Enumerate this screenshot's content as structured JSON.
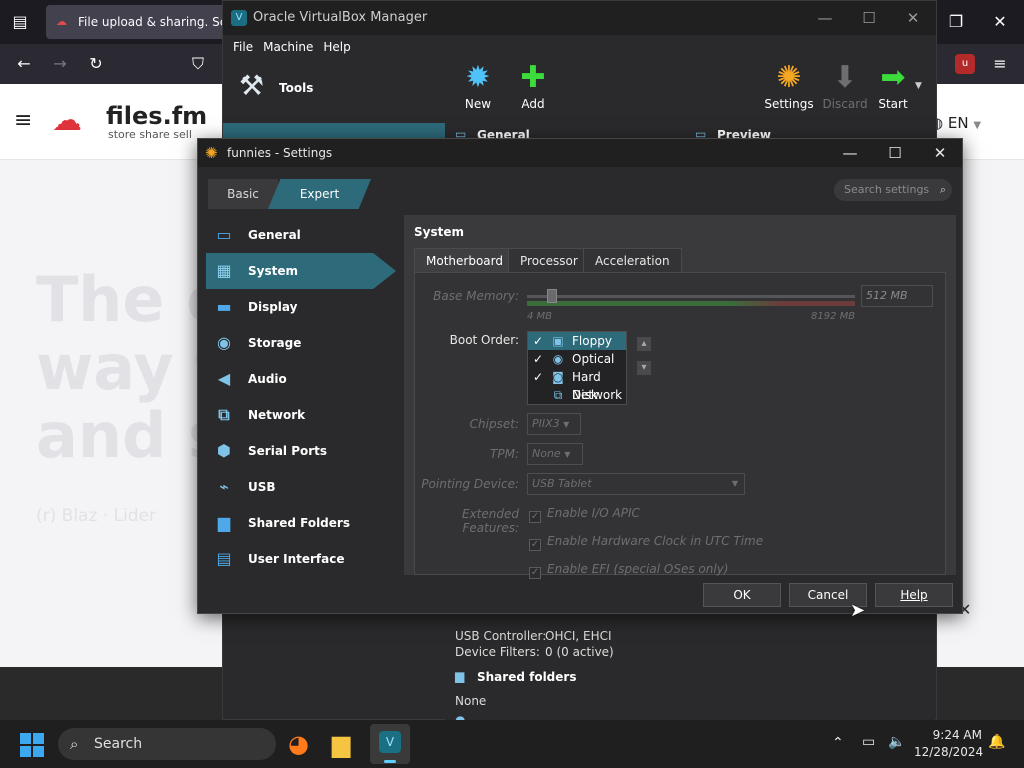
{
  "browser": {
    "tab_title": "File upload & sharing. Send",
    "site_logo_text": "files.fm",
    "site_tagline": "store share sell",
    "language": "EN",
    "hero_lines": [
      "The e",
      "way t",
      "and s"
    ],
    "hero_sub": "(r) Blaz · Lider"
  },
  "vbox_manager": {
    "title": "Oracle VirtualBox Manager",
    "menu": [
      "File",
      "Machine",
      "Help"
    ],
    "tools_label": "Tools",
    "toolbar": [
      {
        "label": "New",
        "icon": "new-icon"
      },
      {
        "label": "Add",
        "icon": "add-icon"
      },
      {
        "label": "Settings",
        "icon": "settings-icon"
      },
      {
        "label": "Discard",
        "icon": "discard-icon",
        "disabled": true
      },
      {
        "label": "Start",
        "icon": "start-icon"
      }
    ],
    "details": {
      "general_header": "General",
      "preview_header": "Preview",
      "usb_controller_label": "USB Controller:",
      "usb_controller_value": "OHCI, EHCI",
      "device_filters_label": "Device Filters:",
      "device_filters_value": "0 (0 active)",
      "shared_folders_header": "Shared folders",
      "shared_folders_value": "None"
    }
  },
  "settings_dialog": {
    "title": "funnies - Settings",
    "mode_basic": "Basic",
    "mode_expert": "Expert",
    "search_placeholder": "Search settings",
    "nav": [
      {
        "label": "General",
        "icon": "general-icon"
      },
      {
        "label": "System",
        "icon": "system-icon",
        "selected": true
      },
      {
        "label": "Display",
        "icon": "display-icon"
      },
      {
        "label": "Storage",
        "icon": "storage-icon"
      },
      {
        "label": "Audio",
        "icon": "audio-icon"
      },
      {
        "label": "Network",
        "icon": "network-icon"
      },
      {
        "label": "Serial Ports",
        "icon": "serial-ports-icon"
      },
      {
        "label": "USB",
        "icon": "usb-icon"
      },
      {
        "label": "Shared Folders",
        "icon": "shared-folders-icon"
      },
      {
        "label": "User Interface",
        "icon": "user-interface-icon"
      }
    ],
    "section_title": "System",
    "tabs": [
      "Motherboard",
      "Processor",
      "Acceleration"
    ],
    "base_memory_label": "Base Memory:",
    "base_memory_value": "512 MB",
    "base_memory_min": "4 MB",
    "base_memory_max": "8192 MB",
    "boot_order_label": "Boot Order:",
    "boot_order": [
      {
        "label": "Floppy",
        "checked": true,
        "icon": "floppy-icon"
      },
      {
        "label": "Optical",
        "checked": true,
        "icon": "optical-icon"
      },
      {
        "label": "Hard Disk",
        "checked": true,
        "icon": "hard-disk-icon"
      },
      {
        "label": "Network",
        "checked": false,
        "icon": "network-boot-icon"
      }
    ],
    "chipset_label": "Chipset:",
    "chipset_value": "PIIX3",
    "tpm_label": "TPM:",
    "tpm_value": "None",
    "pointing_label": "Pointing Device:",
    "pointing_value": "USB Tablet",
    "ext_features_label": "Extended Features:",
    "ext_features": [
      "Enable I/O APIC",
      "Enable Hardware Clock in UTC Time",
      "Enable EFI (special OSes only)"
    ],
    "ok_label": "OK",
    "cancel_label": "Cancel",
    "help_label": "Help"
  },
  "taskbar": {
    "search_label": "Search",
    "time": "9:24 AM",
    "date": "12/28/2024"
  },
  "colors": {
    "accent": "#2d6a7a",
    "dialog_bg": "#2a2a2c",
    "pane_bg": "#3a3a3c",
    "taskbar_bg": "#1f1f1f"
  }
}
